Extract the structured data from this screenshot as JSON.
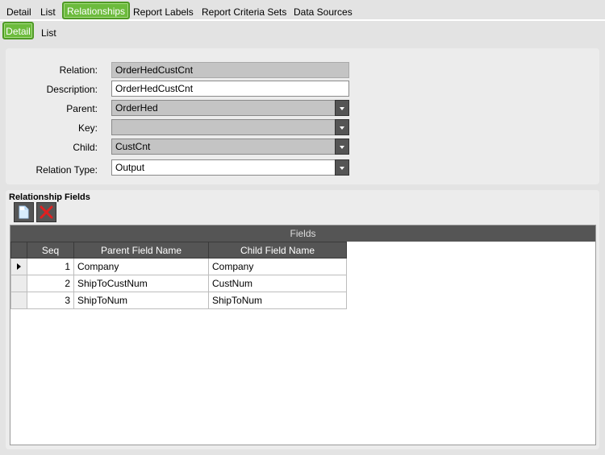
{
  "top_tabs": [
    "Detail",
    "List",
    "Relationships",
    "Report Labels",
    "Report Criteria Sets",
    "Data Sources"
  ],
  "sub_tabs": [
    "Detail",
    "List"
  ],
  "form": {
    "relation_label": "Relation:",
    "relation_value": "OrderHedCustCnt",
    "description_label": "Description:",
    "description_value": "OrderHedCustCnt",
    "parent_label": "Parent:",
    "parent_value": "OrderHed",
    "key_label": "Key:",
    "key_value": "",
    "child_label": "Child:",
    "child_value": "CustCnt",
    "relation_type_label": "Relation Type:",
    "relation_type_value": "Output"
  },
  "relationship_fields": {
    "title": "Relationship Fields",
    "grid_title": "Fields",
    "columns": [
      "Seq",
      "Parent Field Name",
      "Child Field Name"
    ],
    "rows": [
      {
        "seq": "1",
        "parent": "Company",
        "child": "Company"
      },
      {
        "seq": "2",
        "parent": "ShipToCustNum",
        "child": "CustNum"
      },
      {
        "seq": "3",
        "parent": "ShipToNum",
        "child": "ShipToNum"
      }
    ]
  },
  "colors": {
    "tab_active": "#6cbb3c",
    "header_dark": "#555555"
  }
}
